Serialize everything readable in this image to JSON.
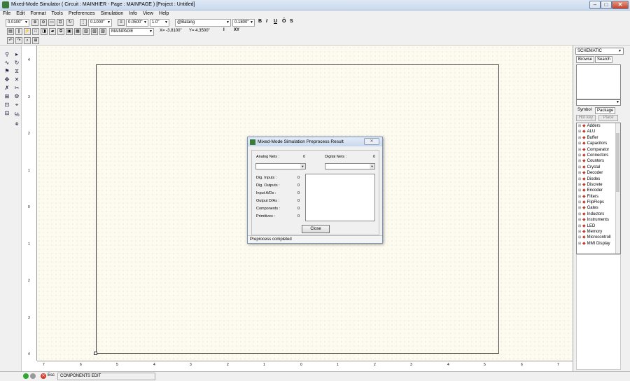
{
  "window": {
    "title": "Mixed-Mode Simulator ( Circuit : MAINHIER - Page : MAINPAGE ) [Project : Untitled]",
    "minimize": "–",
    "maximize": "□",
    "close": "✕"
  },
  "menu": [
    "File",
    "Edit",
    "Format",
    "Tools",
    "Preferences",
    "Simulation",
    "Info",
    "View",
    "Help"
  ],
  "toolbar": {
    "grid_snap": "0.0100\"",
    "grid_size": "0.1000\"",
    "wire_width": "0.0500\"",
    "zoom": "1.0\"",
    "font": "@Batang",
    "font_size": "0.1800\"",
    "bold": "B",
    "italic": "I",
    "underline": "U",
    "overline": "Ō",
    "strike": "S",
    "page": "MAINPAGE",
    "x_readout": "X= -3.8100\"",
    "y_readout": "Y= 4.3500\"",
    "ix_label": "I",
    "xy_label": "XY"
  },
  "vruler_ticks": [
    "4",
    "3",
    "2",
    "1",
    "0",
    "1",
    "2",
    "3",
    "4"
  ],
  "hruler_ticks": [
    "7",
    "6",
    "5",
    "4",
    "3",
    "2",
    "1",
    "0",
    "1",
    "2",
    "3",
    "4",
    "5",
    "6",
    "7"
  ],
  "right_panel": {
    "library_combo": "SCHEMATIC",
    "tab_browse": "Browse",
    "tab_search": "Search",
    "tab_symbol": "Symbol",
    "tab_package": "Package",
    "btn_hotkey": "Hot key",
    "btn_place": "Place",
    "tree": [
      "Adders",
      "ALU",
      "Buffer",
      "Capacitors",
      "Comparator",
      "Connectors",
      "Counters",
      "Crystal",
      "Decoder",
      "Diodes",
      "Discrete",
      "Encoder",
      "Filters",
      "FlipFlops",
      "Gates",
      "Inductors",
      "Instruments",
      "LED",
      "Memory",
      "Microcontroll",
      "MMI Display"
    ]
  },
  "dialog": {
    "title": "Mixed-Mode Simulation Preprocess Result",
    "close_x": "✕",
    "analog_nets_label": "Analog Nets :",
    "analog_nets": "0",
    "digital_nets_label": "Digital Nets :",
    "digital_nets": "0",
    "stats": [
      {
        "label": "Dig. Inputs :",
        "value": "0"
      },
      {
        "label": "Dig. Outputs :",
        "value": "0"
      },
      {
        "label": "Input A/Ds :",
        "value": "0"
      },
      {
        "label": "Output D/As :",
        "value": "0"
      },
      {
        "label": "Components :",
        "value": "0"
      },
      {
        "label": "Primitives :",
        "value": "0"
      }
    ],
    "close_button": "Close",
    "status": "Preprocess completed"
  },
  "statusbar": {
    "esc": "Esc",
    "mode": "COMPONENTS EDIT"
  }
}
